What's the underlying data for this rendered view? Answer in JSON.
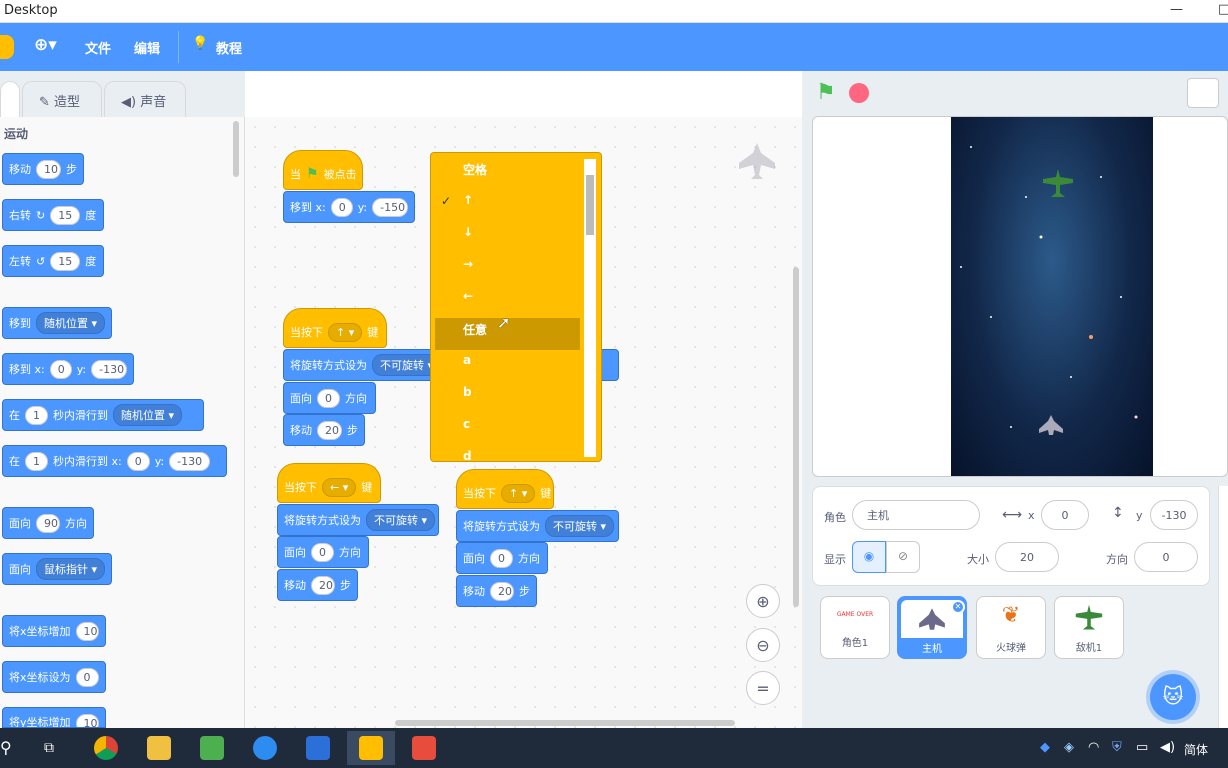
{
  "window": {
    "title": "Desktop"
  },
  "menu": {
    "file": "文件",
    "edit": "编辑",
    "tutorial": "教程"
  },
  "tabs": {
    "costumes": "造型",
    "sounds": "声音"
  },
  "palette": {
    "category": "运动",
    "move": {
      "pre": "移动",
      "val": "10",
      "post": "步"
    },
    "turn_right": {
      "pre": "右转",
      "val": "15",
      "post": "度"
    },
    "turn_left": {
      "pre": "左转",
      "val": "15",
      "post": "度"
    },
    "goto": {
      "pre": "移到",
      "val": "随机位置"
    },
    "goto_xy": {
      "pre": "移到 x:",
      "x": "0",
      "ylbl": "y:",
      "y": "-130"
    },
    "glide": {
      "pre": "在",
      "val": "1",
      "mid": "秒内滑行到",
      "target": "随机位置"
    },
    "glide_xy": {
      "pre": "在",
      "val": "1",
      "mid": "秒内滑行到 x:",
      "x": "0",
      "ylbl": "y:",
      "y": "-130"
    },
    "point_dir": {
      "pre": "面向",
      "val": "90",
      "post": "方向"
    },
    "point_towards": {
      "pre": "面向",
      "val": "鼠标指针"
    },
    "change_x": {
      "pre": "将x坐标增加",
      "val": "10"
    },
    "set_x": {
      "pre": "将x坐标设为",
      "val": "0"
    },
    "change_y": {
      "pre": "将y坐标增加",
      "val": "10"
    }
  },
  "scripts": {
    "s1": {
      "hat_pre": "当",
      "hat_post": "被点击",
      "goto": "移到 x:",
      "x": "0",
      "ylbl": "y:",
      "y": "-150"
    },
    "s2": {
      "hat_pre": "当按下",
      "key": "↑",
      "hat_post": "键",
      "rot": "将旋转方式设为",
      "rotval": "不可旋转",
      "face": "面向",
      "faceval": "0",
      "facepost": "方向",
      "move": "移动",
      "moveval": "20",
      "movepost": "步"
    },
    "s3": {
      "hat_pre": "当按下",
      "key": "←",
      "hat_post": "键",
      "rot": "将旋转方式设为",
      "rotval": "不可旋转",
      "face": "面向",
      "faceval": "0",
      "facepost": "方向",
      "move": "移动",
      "moveval": "20",
      "movepost": "步"
    },
    "s4": {
      "hat_pre": "当按下",
      "key": "↑",
      "hat_post": "键",
      "rot": "将旋转方式设为",
      "rotval": "不可旋转",
      "face": "面向",
      "faceval": "0",
      "facepost": "方向",
      "move": "移动",
      "moveval": "20",
      "movepost": "步"
    }
  },
  "dropdown": {
    "items": [
      "空格",
      "↑",
      "↓",
      "→",
      "←",
      "任意",
      "a",
      "b",
      "c",
      "d"
    ],
    "checked": "✓"
  },
  "sprite_info": {
    "sprite_label": "角色",
    "sprite_name": "主机",
    "x_label": "x",
    "x": "0",
    "y_label": "y",
    "y": "-130",
    "show_label": "显示",
    "size_label": "大小",
    "size": "20",
    "direction_label": "方向",
    "direction": "0"
  },
  "sprites": [
    {
      "name": "角色1",
      "thumb": "GAME OVER"
    },
    {
      "name": "主机",
      "thumb": ""
    },
    {
      "name": "火球弹",
      "thumb": ""
    },
    {
      "name": "敌机1",
      "thumb": ""
    }
  ],
  "taskbar": {
    "ime": "简体"
  },
  "colors": {
    "scratch_blue": "#4c97ff",
    "events_yellow": "#ffbf00",
    "taskbar": "#1f2a3a"
  }
}
